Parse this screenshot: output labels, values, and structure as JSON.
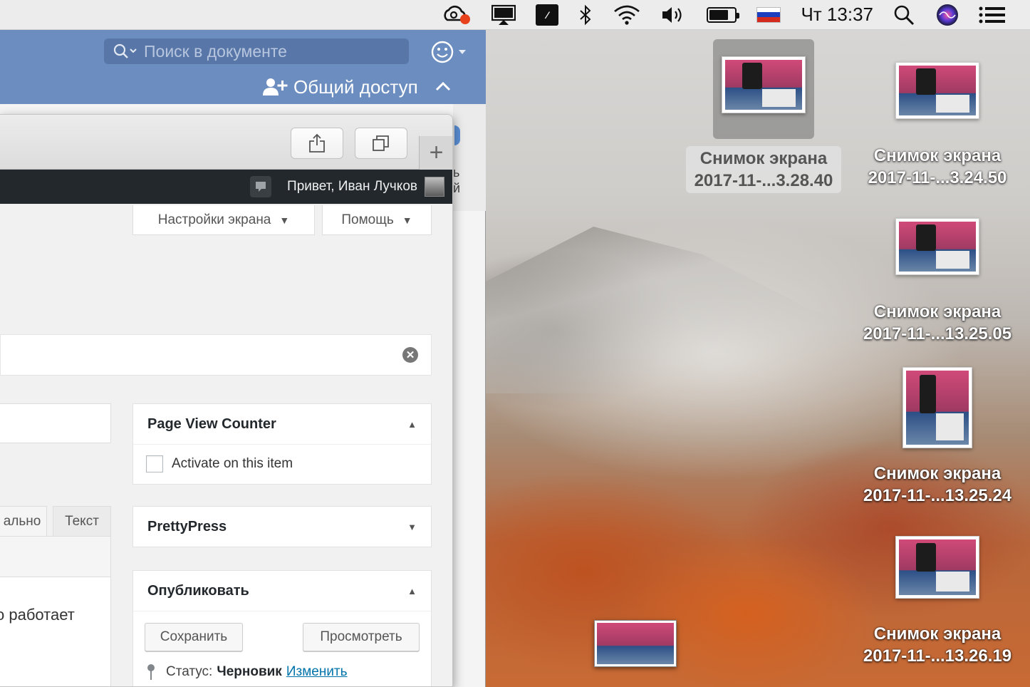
{
  "menubar": {
    "clock": "Чт 13:37",
    "battery_level": 0.75,
    "icons": [
      "creative-cloud-icon",
      "display-icon",
      "app-icon",
      "bluetooth-icon",
      "wifi-icon",
      "volume-icon",
      "battery-icon",
      "russian-flag-icon",
      "spotlight-icon",
      "siri-icon",
      "notification-center-icon"
    ]
  },
  "pages": {
    "search_placeholder": "Поиск в документе",
    "share_label": "Общий доступ",
    "partial_text_1": "ь",
    "partial_text_2": "й"
  },
  "wp": {
    "greeting": "Привет, Иван Лучков",
    "screen_options": "Настройки экрана",
    "help": "Помощь",
    "editor_tab_visual_partial": "ально",
    "editor_tab_text": "Текст",
    "content_partial": "о работает",
    "boxes": {
      "page_view_counter": {
        "title": "Page View Counter",
        "checkbox_label": "Activate on this item"
      },
      "prettypress": {
        "title": "PrettyPress"
      },
      "publish": {
        "title": "Опубликовать",
        "save": "Сохранить",
        "preview": "Просмотреть",
        "status_label": "Статус:",
        "status_value": "Черновик",
        "status_edit": "Изменить"
      }
    }
  },
  "desktop": {
    "files": [
      {
        "line1": "Снимок экрана",
        "line2": "2017-11-...3.28.40",
        "selected": true
      },
      {
        "line1": "Снимок экрана",
        "line2": "2017-11-...3.24.50",
        "selected": false
      },
      {
        "line1": "Снимок экрана",
        "line2": "2017-11-...13.25.05",
        "selected": false
      },
      {
        "line1": "Снимок экрана",
        "line2": "2017-11-...13.25.24",
        "selected": false
      },
      {
        "line1": "Снимок экрана",
        "line2": "2017-11-...13.26.19",
        "selected": false
      }
    ]
  },
  "colors": {
    "pages_toolbar": "#6c8dbf",
    "wp_adminbar": "#23282d",
    "wp_link": "#0073aa",
    "notification_dot": "#e8421c"
  }
}
